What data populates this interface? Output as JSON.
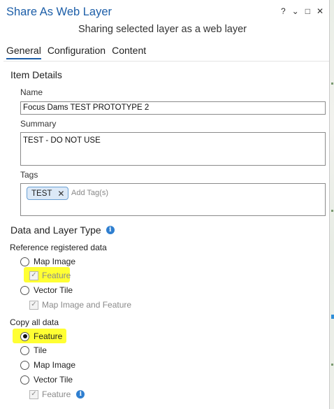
{
  "window": {
    "title": "Share As Web Layer",
    "subtitle": "Sharing selected layer as a web layer",
    "controls": [
      "?",
      "⌄",
      "□",
      "✕"
    ]
  },
  "tabs": [
    {
      "label": "General",
      "active": true
    },
    {
      "label": "Configuration",
      "active": false
    },
    {
      "label": "Content",
      "active": false
    }
  ],
  "item_details": {
    "heading": "Item Details",
    "name_label": "Name",
    "name_value": "Focus Dams TEST PROTOTYPE 2",
    "summary_label": "Summary",
    "summary_value": "TEST - DO NOT USE",
    "tags_label": "Tags",
    "tags": [
      "TEST"
    ],
    "tag_placeholder": "Add Tag(s)"
  },
  "data_layer_type": {
    "heading": "Data and Layer Type",
    "reference_label": "Reference registered data",
    "reference_options": [
      {
        "label": "Map Image",
        "selected": false,
        "sub_check": {
          "label": "Feature",
          "checked": true
        }
      },
      {
        "label": "Vector Tile",
        "selected": false,
        "sub_check": {
          "label": "Map Image and Feature",
          "checked": true
        }
      }
    ],
    "copy_label": "Copy all data",
    "copy_options": [
      {
        "label": "Feature",
        "selected": true
      },
      {
        "label": "Tile",
        "selected": false
      },
      {
        "label": "Map Image",
        "selected": false
      },
      {
        "label": "Vector Tile",
        "selected": false,
        "sub_check": {
          "label": "Feature",
          "checked": true
        }
      }
    ]
  },
  "colors": {
    "title": "#1c5ea8",
    "highlight": "#ffff33",
    "info": "#2f7fd0"
  }
}
